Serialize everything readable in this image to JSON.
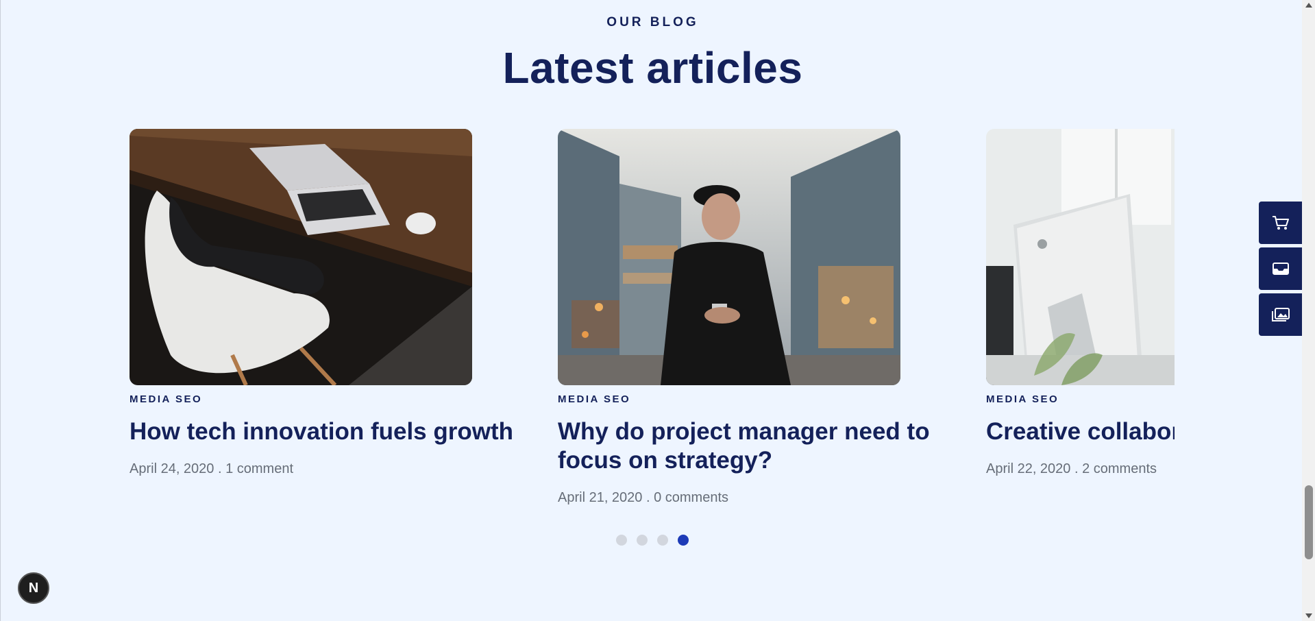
{
  "header": {
    "eyebrow": "OUR BLOG",
    "title": "Latest articles"
  },
  "articles": [
    {
      "category": "MEDIA SEO",
      "title": "How tech innovation fuels growth",
      "date": "April 24, 2020",
      "separator": " . ",
      "comments": "1 comment",
      "image": "laptop-desk-chair-photo"
    },
    {
      "category": "MEDIA SEO",
      "title": "Why do project manager need to focus on strategy?",
      "date": "April 21, 2020",
      "separator": " . ",
      "comments": "0 comments",
      "image": "man-with-phone-city-photo"
    },
    {
      "category": "MEDIA SEO",
      "title": "Creative collaboration teams",
      "date": "April 22, 2020",
      "separator": " . ",
      "comments": "2 comments",
      "image": "imac-office-photo"
    }
  ],
  "carousel": {
    "dots": 4,
    "active_index": 3,
    "active_color": "#1d3bb7",
    "inactive_color": "#d2d6de"
  },
  "side_toolbar": {
    "items": [
      "cart-icon",
      "inbox-icon",
      "gallery-icon"
    ],
    "color": "#14215a"
  },
  "badge": {
    "letter": "N"
  },
  "colors": {
    "background": "#eef5ff",
    "primary": "#14215a",
    "muted": "#666d78"
  }
}
